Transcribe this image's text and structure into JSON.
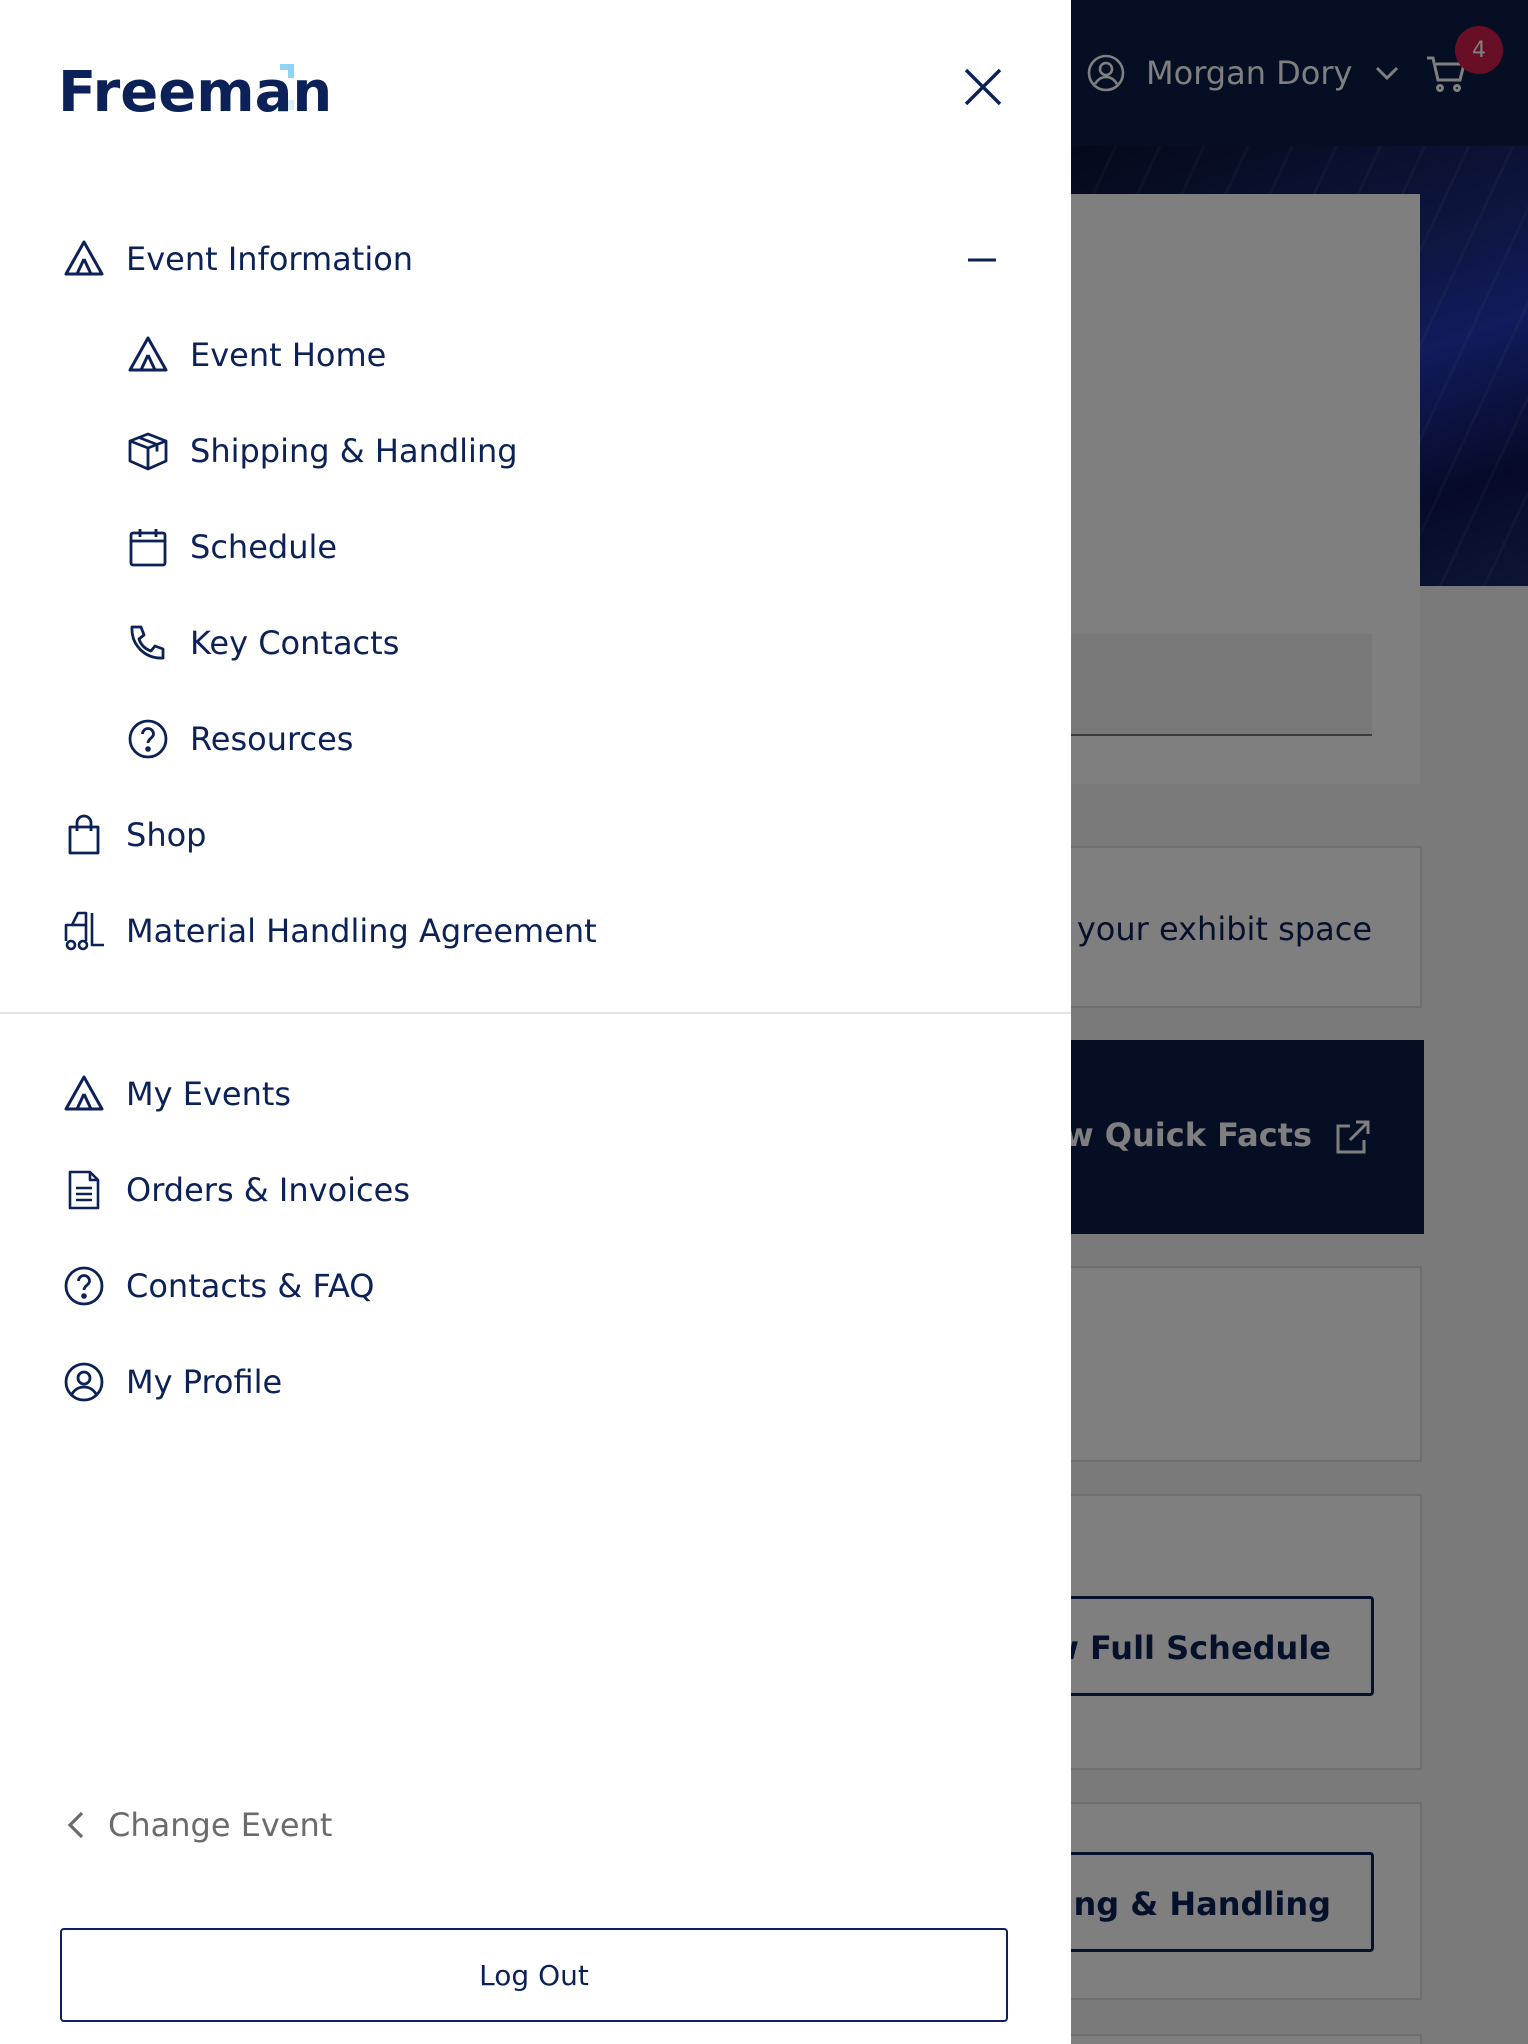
{
  "header": {
    "user_name": "Morgan Dory",
    "cart_count": "4"
  },
  "background": {
    "card_text": "in your exhibit space",
    "quick_facts_label": "View Quick Facts",
    "schedule_button_label": "View Full Schedule",
    "shipping_button_label": "Shipping & Handling"
  },
  "drawer": {
    "logo_text": "Freeman",
    "event_section": {
      "label": "Event Information",
      "expanded": true,
      "items": [
        {
          "label": "Event Home",
          "icon": "event-icon"
        },
        {
          "label": "Shipping & Handling",
          "icon": "box-icon"
        },
        {
          "label": "Schedule",
          "icon": "calendar-icon"
        },
        {
          "label": "Key Contacts",
          "icon": "phone-icon"
        },
        {
          "label": "Resources",
          "icon": "help-circle-icon"
        }
      ]
    },
    "shop_label": "Shop",
    "mha_label": "Material Handling Agreement",
    "account_items": [
      {
        "label": "My Events",
        "icon": "event-icon"
      },
      {
        "label": "Orders & Invoices",
        "icon": "document-icon"
      },
      {
        "label": "Contacts & FAQ",
        "icon": "help-circle-icon"
      },
      {
        "label": "My Profile",
        "icon": "user-circle-icon"
      }
    ],
    "change_event_label": "Change Event",
    "logout_label": "Log Out"
  },
  "colors": {
    "brand_navy": "#0b2157",
    "topbar": "#0c1d48",
    "badge": "#d21e4b",
    "logo_accent": "#8fd3f5"
  }
}
